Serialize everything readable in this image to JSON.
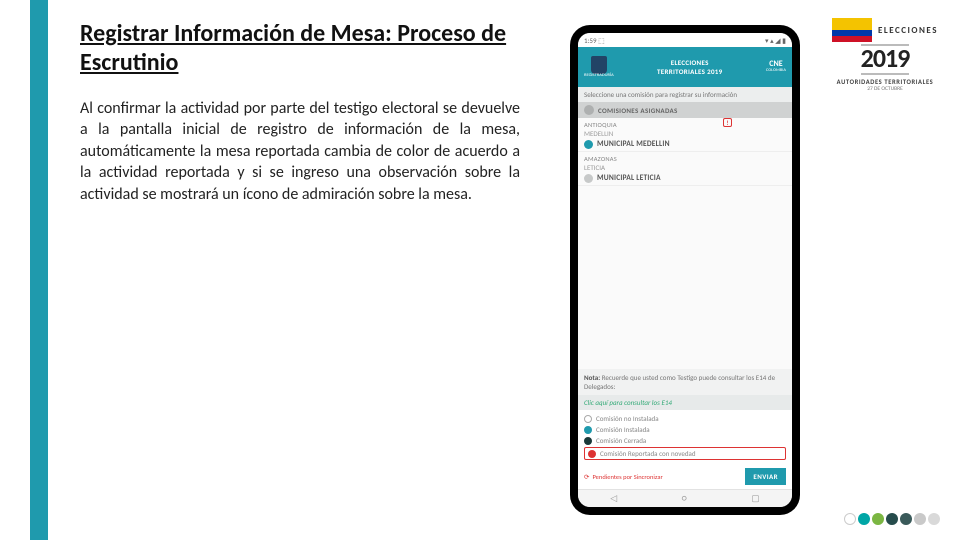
{
  "title": "Registrar Información de Mesa: Proceso de Escrutinio",
  "paragraph": "Al confirmar la actividad por parte del testigo electoral se devuelve a la pantalla inicial de registro de información de la mesa, automáticamente la mesa reportada cambia de color de acuerdo a la actividad reportada y si se ingreso una observación sobre la actividad se mostrará un ícono de admiración sobre la mesa.",
  "phone": {
    "status_time": "1:59 ⬚",
    "header_title": "ELECCIONES\nTERRITORIALES 2019",
    "header_left": "REGISTRADURÍA",
    "header_right": "CNE",
    "subhead": "Seleccione una comisión para registrar su información",
    "com_header": "COMISIONES ASIGNADAS",
    "items": [
      {
        "region": "ANTIOQUIA",
        "city": "MEDELLIN",
        "muni": "MUNICIPAL MEDELLIN",
        "dot": "teal",
        "alert": "!"
      },
      {
        "region": "AMAZONAS",
        "city": "LETICIA",
        "muni": "MUNICIPAL LETICIA",
        "dot": "grey",
        "alert": ""
      }
    ],
    "note_label": "Nota:",
    "note_text": "Recuerde que usted como Testigo puede consultar los E14 de Delegados:",
    "link": "Clic aquí para consultar los E14",
    "legend": {
      "l1": "Comisión no Instalada",
      "l2": "Comisión Instalada",
      "l3": "Comisión Cerrada",
      "l4": "Comisión Reportada con novedad"
    },
    "pending": "Pendientes por Sincronizar",
    "send": "ENVIAR"
  },
  "logo": {
    "line": "ELECCIONES",
    "year": "2019",
    "sub": "AUTORIDADES TERRITORIALES",
    "date": "27 DE OCTUBRE"
  }
}
